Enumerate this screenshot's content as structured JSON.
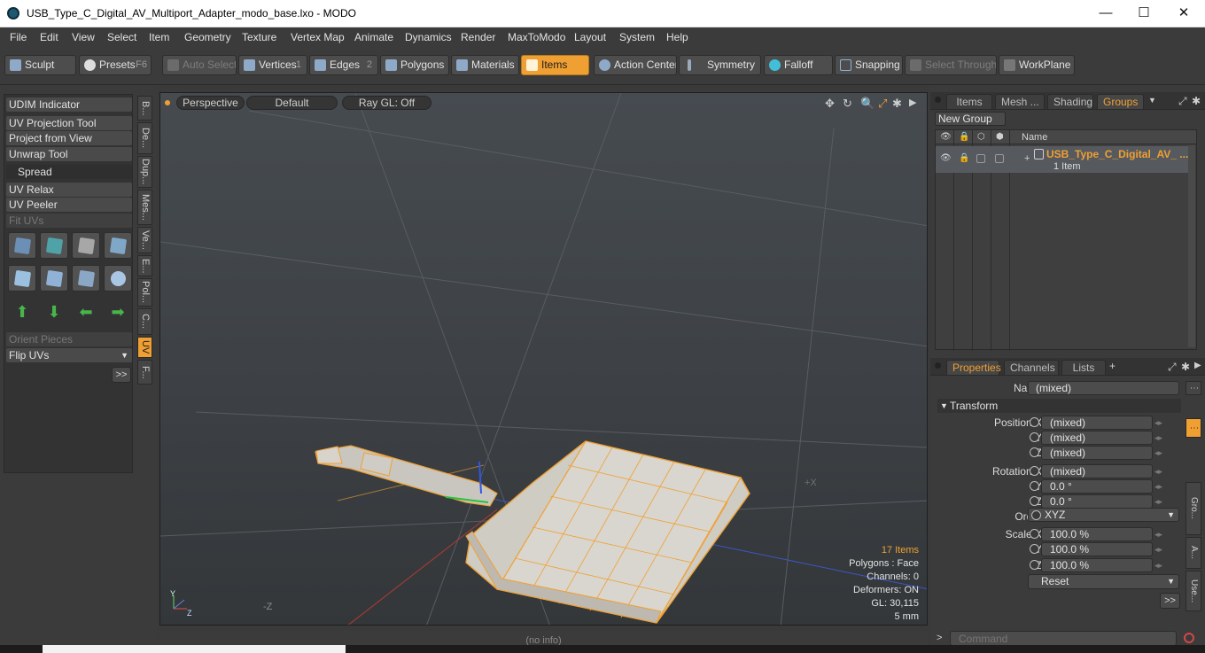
{
  "window": {
    "title": "USB_Type_C_Digital_AV_Multiport_Adapter_modo_base.lxo - MODO",
    "minimize": "—",
    "maximize": "☐",
    "close": "✕"
  },
  "menu": [
    "File",
    "Edit",
    "View",
    "Select",
    "Item",
    "Geometry",
    "Texture",
    "Vertex Map",
    "Animate",
    "Dynamics",
    "Render",
    "MaxToModo",
    "Layout",
    "System",
    "Help"
  ],
  "toolbar": {
    "sculpt": "Sculpt",
    "presets": "Presets",
    "presets_key": "F6",
    "auto_select": "Auto Select",
    "vertices": "Vertices",
    "vertices_count": "1",
    "edges": "Edges",
    "edges_count": "2",
    "polygons": "Polygons",
    "materials": "Materials",
    "items": "Items",
    "action_center": "Action Center",
    "symmetry": "Symmetry",
    "falloff": "Falloff",
    "snapping": "Snapping",
    "select_through": "Select Through",
    "workplane": "WorkPlane"
  },
  "left_tools": {
    "udim": "UDIM Indicator",
    "uv_projection": "UV Projection Tool",
    "project_from_view": "Project from View",
    "unwrap": "Unwrap Tool",
    "spread": "Spread",
    "uv_relax": "UV Relax",
    "uv_peeler": "UV Peeler",
    "fit_uvs": "Fit UVs",
    "orient_pieces": "Orient Pieces",
    "flip_uvs": "Flip UVs",
    "more": ">>"
  },
  "left_vtabs": [
    "B...",
    "De...",
    "Dup...",
    "Mes...",
    "Ve...",
    "E...",
    "Pol...",
    "C...",
    "UV",
    "F..."
  ],
  "viewport": {
    "perspective": "Perspective",
    "shading": "Default",
    "raygl": "Ray GL: Off",
    "axis_z": "-Z",
    "axis_x": "+X",
    "info_items": "17 Items",
    "info_polygons": "Polygons : Face",
    "info_channels": "Channels: 0",
    "info_deformers": "Deformers: ON",
    "info_gl": "GL: 30,115",
    "info_scale": "5 mm",
    "status": "(no info)"
  },
  "groups_panel": {
    "tabs": [
      "Items",
      "Mesh ...",
      "Shading",
      "Groups"
    ],
    "new_group": "New Group",
    "col_name": "Name",
    "group_name": "USB_Type_C_Digital_AV_ ...",
    "group_sub": "1 Item"
  },
  "props_panel": {
    "tabs": [
      "Properties",
      "Channels",
      "Lists"
    ],
    "add": "+",
    "name_label": "Name",
    "name_value": "(mixed)",
    "transform": "Transform",
    "pos_x_label": "Position X",
    "pos_x": "(mixed)",
    "pos_y_label": "Y",
    "pos_y": "(mixed)",
    "pos_z_label": "Z",
    "pos_z": "(mixed)",
    "rot_x_label": "Rotation X",
    "rot_x": "(mixed)",
    "rot_y_label": "Y",
    "rot_y": "0.0 °",
    "rot_z_label": "Z",
    "rot_z": "0.0 °",
    "order_label": "Order",
    "order_value": "XYZ",
    "scale_x_label": "Scale X",
    "scale_x": "100.0 %",
    "scale_y_label": "Y",
    "scale_y": "100.0 %",
    "scale_z_label": "Z",
    "scale_z": "100.0 %",
    "reset": "Reset",
    "more": ">>",
    "side_tabs": [
      "Gro...",
      "A...",
      "Use..."
    ]
  },
  "command": {
    "prompt": ">",
    "placeholder": "Command"
  },
  "colors": {
    "accent": "#f0a032",
    "panel": "#3b3b3b",
    "viewport": "#3d4145"
  }
}
